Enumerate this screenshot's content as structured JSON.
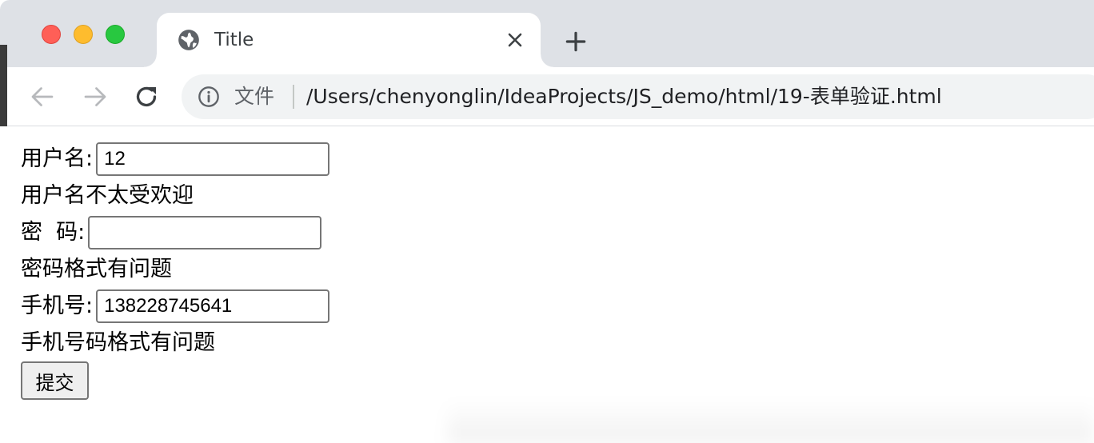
{
  "browser": {
    "tab": {
      "title": "Title",
      "icon": "globe-icon"
    },
    "omnibox": {
      "scheme_label": "文件",
      "url": "/Users/chenyonglin/IdeaProjects/JS_demo/html/19-表单验证.html"
    }
  },
  "form": {
    "username": {
      "label": "用户名:",
      "value": "12",
      "message": "用户名不太受欢迎"
    },
    "password": {
      "label": "密  码:",
      "value": "",
      "message": "密码格式有问题"
    },
    "phone": {
      "label": "手机号:",
      "value": "138228745641",
      "message": "手机号码格式有问题"
    },
    "submit_label": "提交"
  },
  "colors": {
    "traffic_close": "#ff5f57",
    "traffic_minimize": "#febc2e",
    "traffic_maximize": "#28c840"
  }
}
